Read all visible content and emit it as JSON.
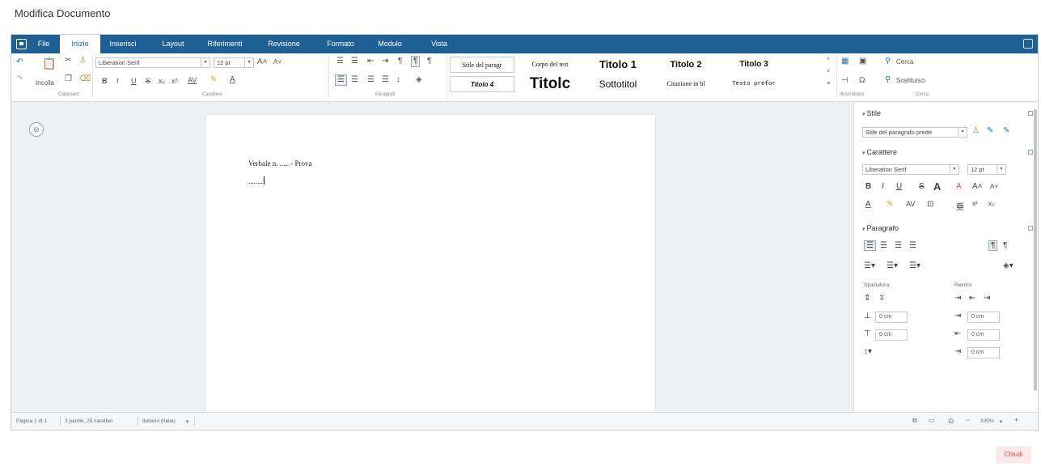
{
  "page": {
    "title": "Modifica Documento"
  },
  "menubar": {
    "tabs": [
      {
        "label": "File"
      },
      {
        "label": "Inizio"
      },
      {
        "label": "Inserisci"
      },
      {
        "label": "Layout"
      },
      {
        "label": "Riferimenti"
      },
      {
        "label": "Revisione"
      },
      {
        "label": "Formato"
      },
      {
        "label": "Modulo"
      },
      {
        "label": "Vista"
      }
    ],
    "active_tab": "Inizio"
  },
  "ribbon": {
    "paste_label": "Incolla",
    "font_name": "Liberation Serif",
    "font_size": "12 pt",
    "format_buttons": [
      "B",
      "I",
      "U",
      "S",
      "x₂",
      "x²"
    ],
    "groups": {
      "clipboard": "Clipboard",
      "character": "Carattere",
      "paragraph": "Paragrafi",
      "illustrations": "Illustrations",
      "search": "Cerca"
    },
    "styles": [
      {
        "label": "Stile del paragr"
      },
      {
        "label": "Corpo del test"
      },
      {
        "label": "Titolo 1"
      },
      {
        "label": "Titolo 2"
      },
      {
        "label": "Titolo 3"
      },
      {
        "label": "Titolo 4"
      },
      {
        "label": "Titolc"
      },
      {
        "label": "Sottotitol"
      },
      {
        "label": "Citazione in bl"
      },
      {
        "label": "Testo prefor"
      }
    ],
    "search_label": "Cerca",
    "replace_label": "Sostituisci"
  },
  "document": {
    "line1": "Verbale n. ..... - Prova",
    "line2": "........"
  },
  "sidebar": {
    "styles_section": "Stile",
    "paragraph_style": "Stile del paragrafo prede",
    "character_section": "Carattere",
    "font_name": "Liberation Serif",
    "font_size": "12 pt",
    "paragraph_section": "Paragrafo",
    "spacing_label": "Spaziatura:",
    "indent_label": "Rientro:",
    "zero_value": "0",
    "unit": "cm"
  },
  "statusbar": {
    "page_info": "Pagina 1 di 1",
    "word_count": "3 parole, 25 caratteri",
    "language": "Italiano (Italia)",
    "zoom": "100%"
  },
  "footer": {
    "close_label": "Chiudi"
  },
  "colors": {
    "menubar": "#1e5f94",
    "close_text": "#d54b4b",
    "close_bg": "#fbeaea"
  }
}
